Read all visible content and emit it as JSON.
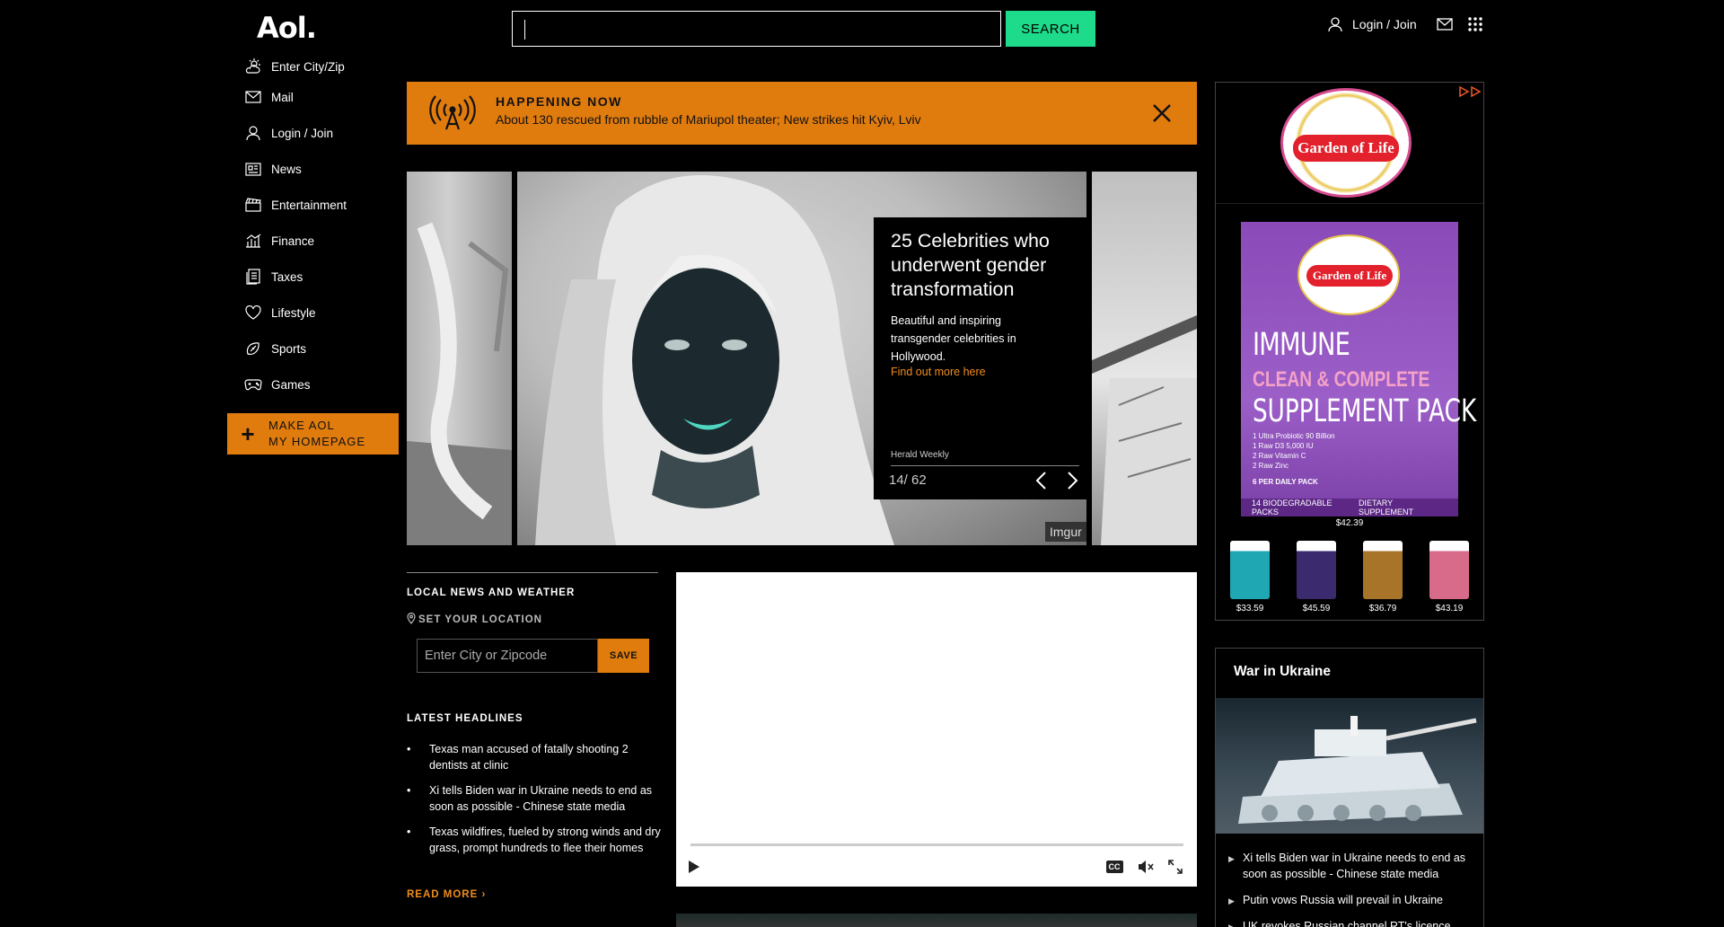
{
  "header": {
    "logo": "Aol.",
    "search_placeholder": "",
    "search_button": "SEARCH",
    "login_label": "Login / Join"
  },
  "nav": {
    "items": [
      {
        "label": "Enter City/Zip",
        "icon": "weather-icon"
      },
      {
        "label": "Mail",
        "icon": "mail-icon"
      },
      {
        "label": "Login / Join",
        "icon": "user-icon"
      },
      {
        "label": "News",
        "icon": "news-icon"
      },
      {
        "label": "Entertainment",
        "icon": "clapper-icon"
      },
      {
        "label": "Finance",
        "icon": "chart-icon"
      },
      {
        "label": "Taxes",
        "icon": "document-icon"
      },
      {
        "label": "Lifestyle",
        "icon": "heart-icon"
      },
      {
        "label": "Sports",
        "icon": "football-icon"
      },
      {
        "label": "Games",
        "icon": "gamepad-icon"
      }
    ],
    "make_homepage_line1": "MAKE AOL",
    "make_homepage_line2": "MY HOMEPAGE"
  },
  "alert": {
    "label": "HAPPENING NOW",
    "headline": "About 130 rescued from rubble of Mariupol theater; New strikes hit Kyiv, Lviv"
  },
  "carousel": {
    "title": "25 Celebrities who underwent gender transformation",
    "description": "Beautiful and inspiring transgender celebrities in Hollywood.",
    "link": "Find out more here",
    "source": "Herald Weekly",
    "counter": "14/ 62",
    "credit": "Imgur"
  },
  "local": {
    "heading": "LOCAL NEWS AND WEATHER",
    "set_location": "SET YOUR LOCATION",
    "zip_placeholder": "Enter City or Zipcode",
    "save": "SAVE"
  },
  "latest": {
    "heading": "LATEST HEADLINES",
    "items": [
      "Texas man accused of fatally shooting 2 dentists at clinic",
      "Xi tells Biden war in Ukraine needs to end as soon as possible - Chinese state media",
      "Texas wildfires, fueled by strong winds and dry grass, prompt hundreds to flee their homes"
    ],
    "read_more": "READ MORE ›"
  },
  "video": {
    "cc_label": "CC"
  },
  "ad": {
    "brand": "Garden of Life",
    "product_line1": "IMMUNE",
    "product_line2": "CLEAN & COMPLETE",
    "product_line3": "SUPPLEMENT PACK",
    "ingredients": [
      "1 Ultra Probiotic 90 Billion",
      "1 Raw D3 5,000 IU",
      "2 Raw Vitamin C",
      "2 Raw Zinc"
    ],
    "per_daily": "6 PER DAILY PACK",
    "foot_left": "14 BIODEGRADABLE PACKS",
    "foot_right": "DIETARY SUPPLEMENT",
    "main_price": "$42.39",
    "minis": [
      {
        "price": "$33.59",
        "color": "#1fa7b4"
      },
      {
        "price": "$45.59",
        "color": "#3b2a6e"
      },
      {
        "price": "$36.79",
        "color": "#a8742a"
      },
      {
        "price": "$43.19",
        "color": "#d86a8a"
      }
    ]
  },
  "war": {
    "heading": "War in Ukraine",
    "items": [
      "Xi tells Biden war in Ukraine needs to end as soon as possible - Chinese state media",
      "Putin vows Russia will prevail in Ukraine",
      "UK revokes Russian channel RT's licence"
    ]
  }
}
